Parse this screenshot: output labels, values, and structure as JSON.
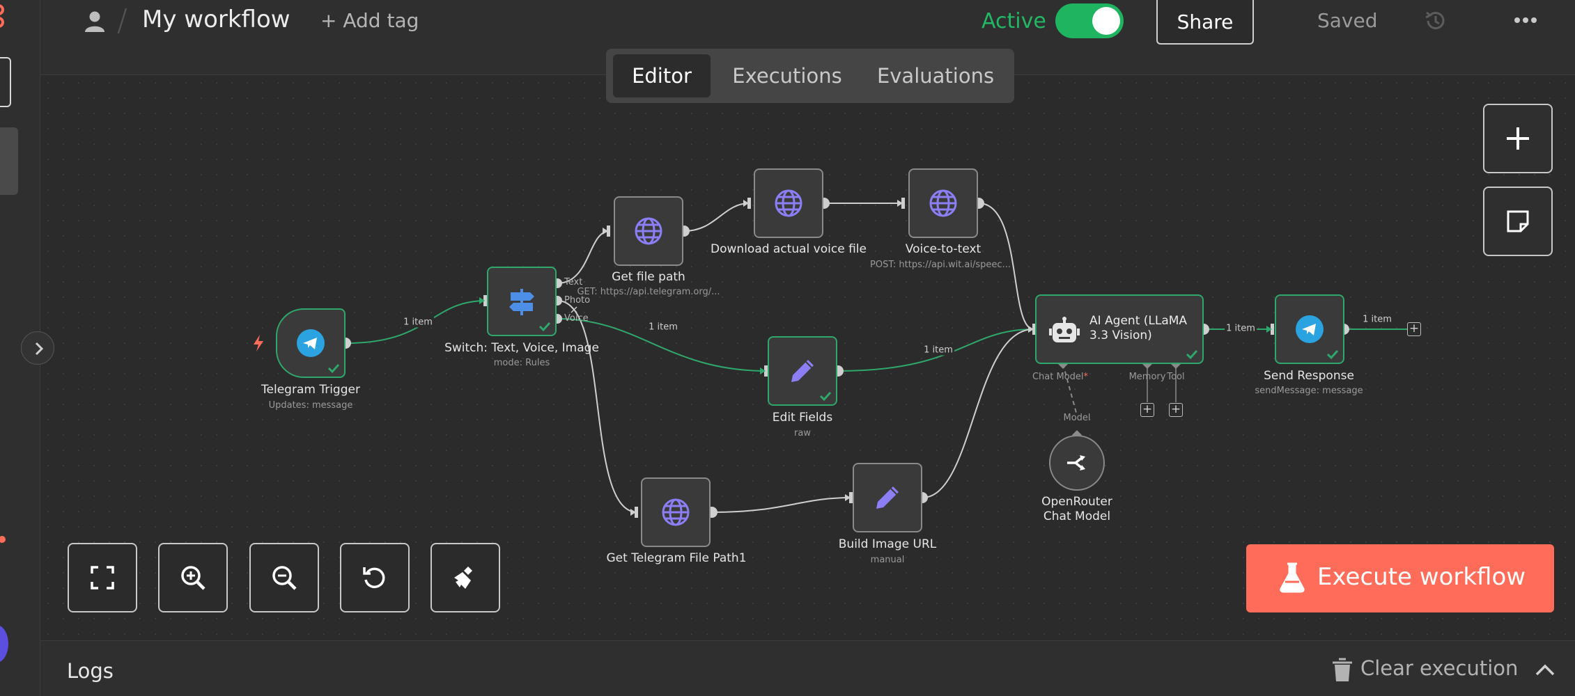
{
  "header": {
    "title": "My workflow",
    "add_tag": "+ Add tag",
    "status": "Active",
    "share": "Share",
    "saved": "Saved"
  },
  "tabs": [
    "Editor",
    "Executions",
    "Evaluations"
  ],
  "nodes": {
    "telegram_trigger": {
      "label": "Telegram Trigger",
      "sub": "Updates: message"
    },
    "switch": {
      "label": "Switch: Text, Voice, Image",
      "sub": "mode: Rules",
      "outputs": [
        "Text",
        "Photo",
        "Voice"
      ]
    },
    "get_file_path": {
      "label": "Get file path",
      "sub": "GET: https://api.telegram.org/..."
    },
    "download_voice": {
      "label": "Download actual voice file"
    },
    "voice_to_text": {
      "label": "Voice-to-text",
      "sub": "POST: https://api.wit.ai/speec..."
    },
    "edit_fields": {
      "label": "Edit Fields",
      "sub": "raw"
    },
    "get_telegram_file_path1": {
      "label": "Get Telegram File Path1"
    },
    "build_image_url": {
      "label": "Build Image URL",
      "sub": "manual"
    },
    "ai_agent": {
      "label": "AI Agent (LLaMA 3.3 Vision)",
      "ports": [
        "Chat Model",
        "Memory",
        "Tool"
      ],
      "required_mark": "*"
    },
    "openrouter": {
      "label": "OpenRouter Chat Model",
      "port": "Model"
    },
    "send_response": {
      "label": "Send Response",
      "sub": "sendMessage: message"
    }
  },
  "edge_labels": {
    "trigger_to_switch": "1 item",
    "switch_to_edit": "1 item",
    "edit_to_agent": "1 item",
    "agent_to_send": "1 item",
    "send_out": "1 item"
  },
  "actions": {
    "execute": "Execute workflow"
  },
  "logs": {
    "title": "Logs",
    "clear": "Clear execution"
  },
  "colors": {
    "accent": "#ff6d5a",
    "success": "#22b866",
    "node_border": "#8a8a8a",
    "http_icon": "#8c7ff5",
    "telegram": "#2aa3e0"
  },
  "icons": {
    "trigger": "telegram-icon",
    "switch": "signpost-icon",
    "http": "globe-icon",
    "set": "pencil-icon",
    "agent": "robot-icon",
    "model": "openrouter-icon"
  }
}
